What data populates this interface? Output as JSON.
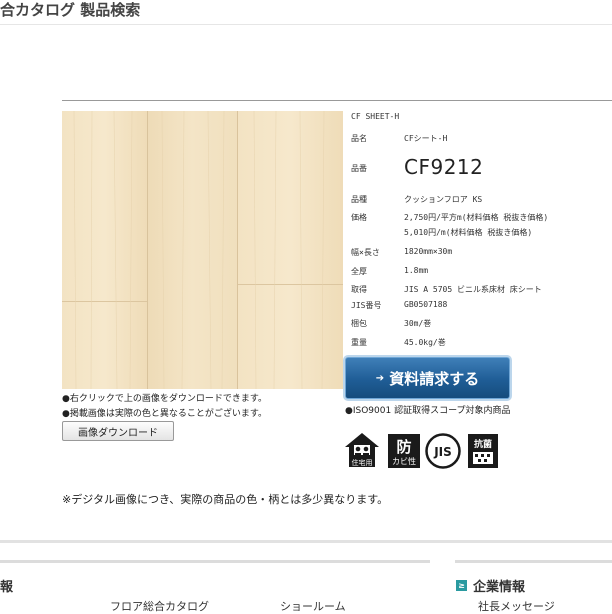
{
  "page": {
    "title": "合カタログ 製品検索"
  },
  "product": {
    "header": "CF SHEET-H",
    "specs": [
      {
        "label": "品名",
        "value": "CFシート-H"
      },
      {
        "label": "品番",
        "value": "CF9212"
      },
      {
        "label": "品種",
        "value": "クッションフロア KS"
      },
      {
        "label": "価格",
        "value": "2,750円/平方m(材料価格 税抜き価格)"
      },
      {
        "label": "",
        "value": "5,010円/m(材料価格 税抜き価格)"
      },
      {
        "label": "幅×長さ",
        "value": "1820mm×30m"
      },
      {
        "label": "全厚",
        "value": "1.8mm"
      },
      {
        "label": "取得",
        "value": "JIS A 5705 ビニル系床材 床シート"
      },
      {
        "label": "JIS番号",
        "value": "GB0507188"
      },
      {
        "label": "梱包",
        "value": "30m/巻"
      },
      {
        "label": "重量",
        "value": "45.0kg/巻"
      }
    ]
  },
  "actions": {
    "request_arrow": "➔",
    "request_label": "資料請求する",
    "download_label": "画像ダウンロード"
  },
  "notes": {
    "right_click": "●右クリックで上の画像をダウンロードできます。",
    "color_diff": "●掲載画像は実際の色と異なることがございます。",
    "iso": "●ISO9001 認証取得スコープ対象内商品",
    "disclaimer": "※デジタル画像につき、実際の商品の色・柄とは多少異なります。"
  },
  "badges": {
    "house_label": "住宅用",
    "bou_char": "防",
    "kabi_label": "カビ性",
    "jis_label": "JIS",
    "kokin_label": "抗菌"
  },
  "footer": {
    "left_heading": "報",
    "right_marker": "≥",
    "right_heading": "企業情報",
    "links": [
      "フロア総合カタログ",
      "ショールーム",
      "社長メッセージ"
    ]
  },
  "colors": {
    "accent_blue": "#1f5d96",
    "teal_marker": "#2a9aa0",
    "wood_base": "#f1e0c0"
  }
}
